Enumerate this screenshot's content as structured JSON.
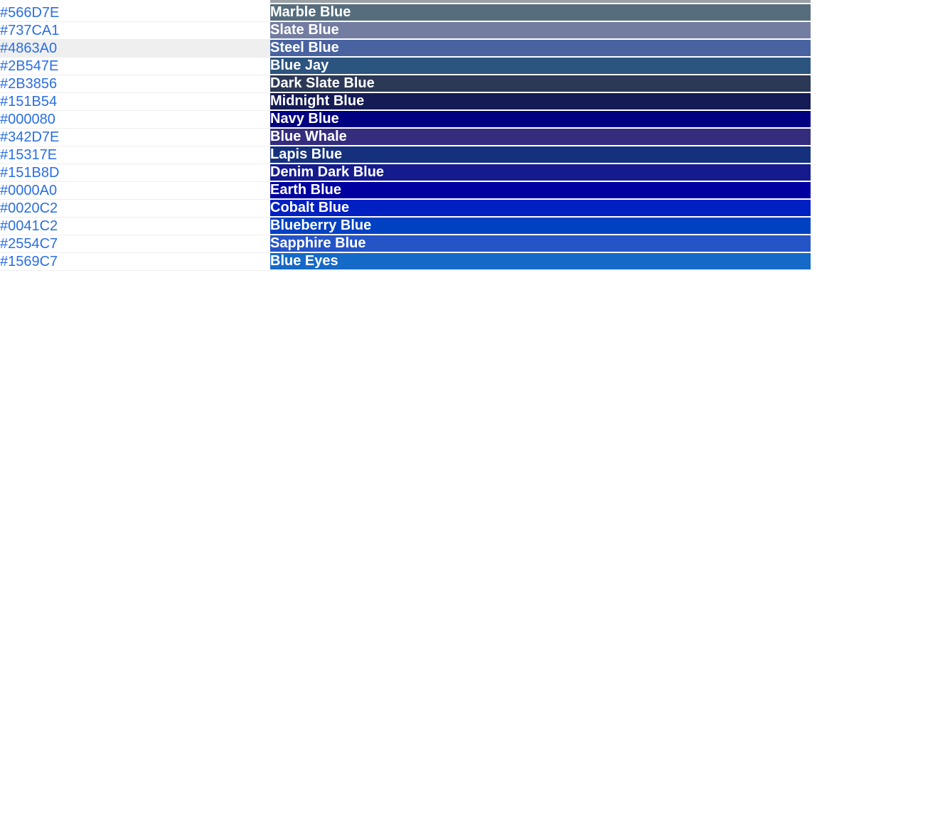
{
  "colors": [
    {
      "hex": "#566D7E",
      "name": "Marble Blue",
      "bg": "#566D7E",
      "hovered": false
    },
    {
      "hex": "#737CA1",
      "name": "Slate Blue",
      "bg": "#737CA1",
      "hovered": false
    },
    {
      "hex": "#4863A0",
      "name": "Steel Blue",
      "bg": "#4863A0",
      "hovered": true
    },
    {
      "hex": "#2B547E",
      "name": "Blue Jay",
      "bg": "#2B547E",
      "hovered": false
    },
    {
      "hex": "#2B3856",
      "name": "Dark Slate Blue",
      "bg": "#2B3856",
      "hovered": false
    },
    {
      "hex": "#151B54",
      "name": "Midnight Blue",
      "bg": "#151B54",
      "hovered": false
    },
    {
      "hex": "#000080",
      "name": "Navy Blue",
      "bg": "#000080",
      "hovered": false
    },
    {
      "hex": "#342D7E",
      "name": "Blue Whale",
      "bg": "#342D7E",
      "hovered": false
    },
    {
      "hex": "#15317E",
      "name": "Lapis Blue",
      "bg": "#15317E",
      "hovered": false
    },
    {
      "hex": "#151B8D",
      "name": "Denim Dark Blue",
      "bg": "#151B8D",
      "hovered": false
    },
    {
      "hex": "#0000A0",
      "name": "Earth Blue",
      "bg": "#0000A0",
      "hovered": false
    },
    {
      "hex": "#0020C2",
      "name": "Cobalt Blue",
      "bg": "#0020C2",
      "hovered": false
    },
    {
      "hex": "#0041C2",
      "name": "Blueberry Blue",
      "bg": "#0041C2",
      "hovered": false
    },
    {
      "hex": "#2554C7",
      "name": "Sapphire Blue",
      "bg": "#2554C7",
      "hovered": false
    },
    {
      "hex": "#1569C7",
      "name": "Blue Eyes",
      "bg": "#1569C7",
      "hovered": false
    }
  ]
}
